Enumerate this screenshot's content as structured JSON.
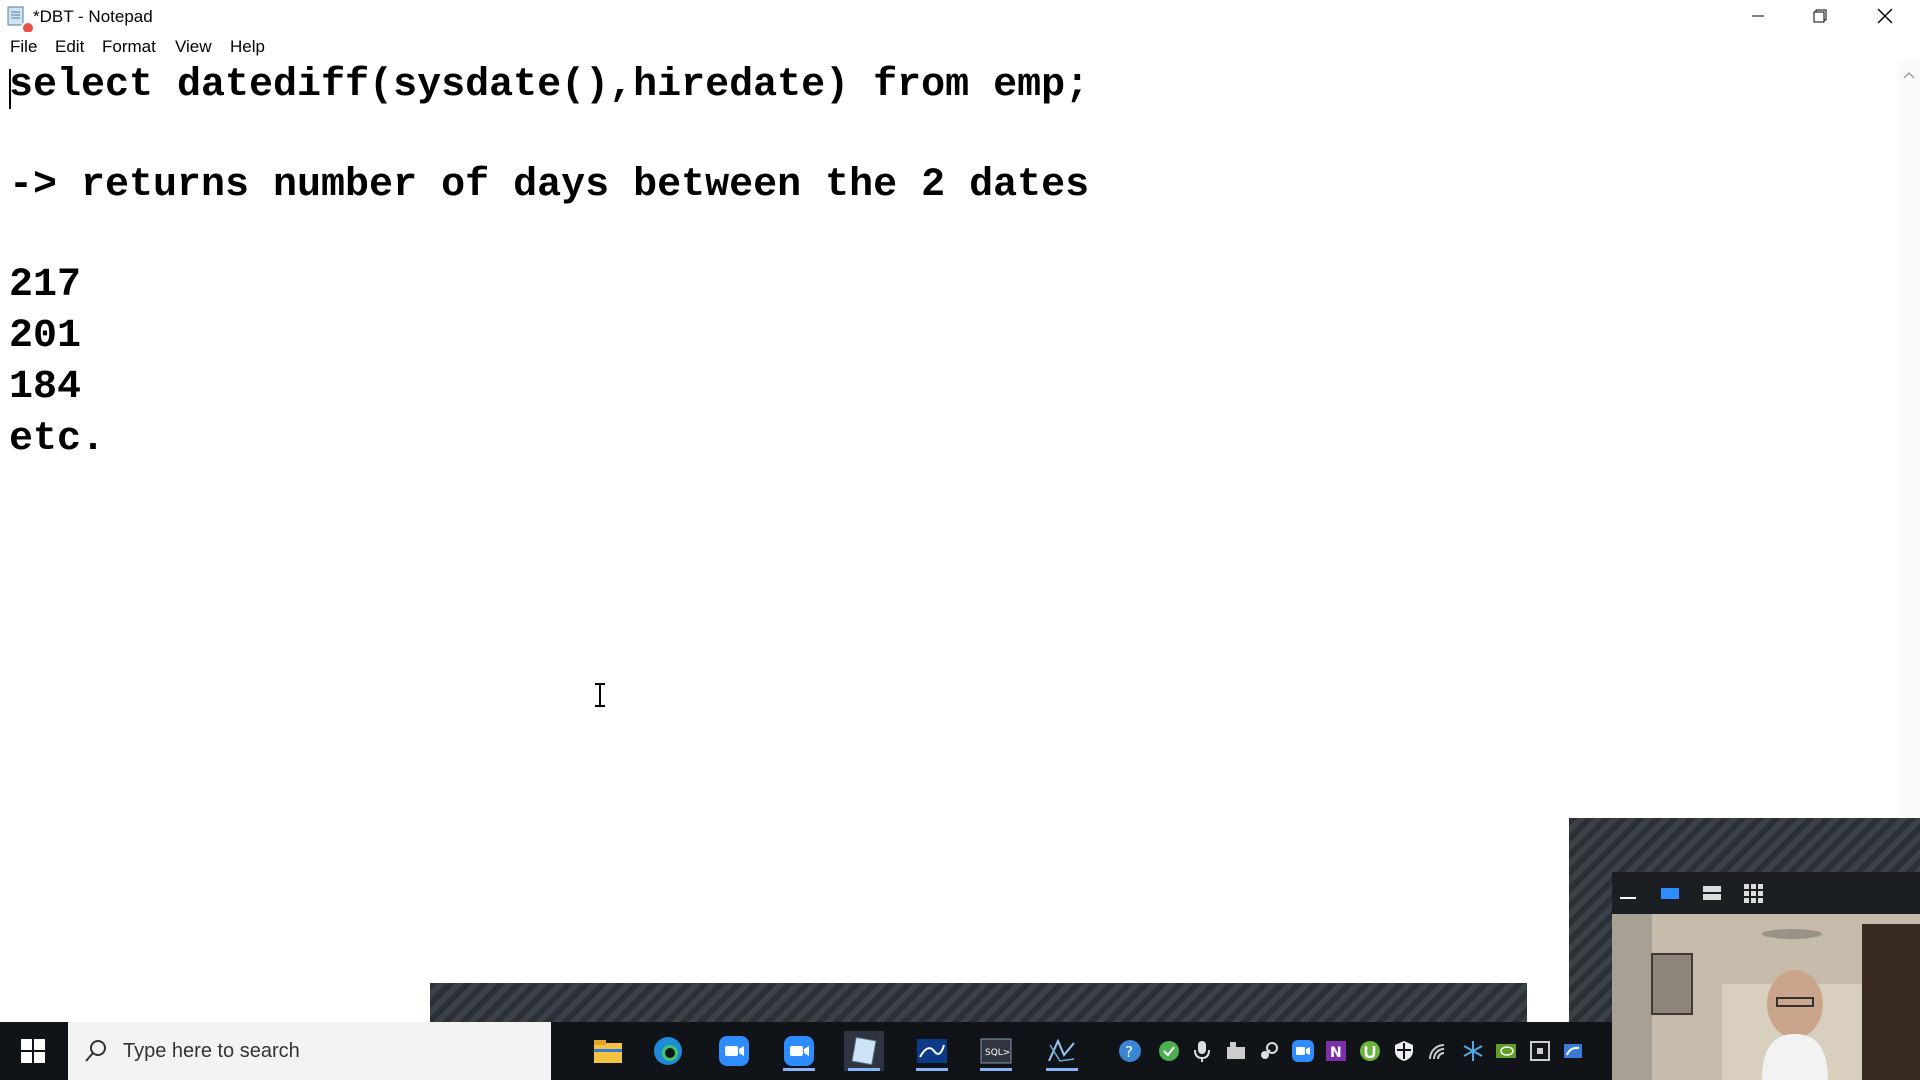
{
  "window": {
    "title": "*DBT - Notepad"
  },
  "menu": {
    "items": [
      "File",
      "Edit",
      "Format",
      "View",
      "Help"
    ]
  },
  "editor": {
    "lines": [
      "select datediff(sysdate(),hiredate) from emp;",
      "-> returns number of days between the 2 dates",
      "217",
      "201",
      "184",
      "etc."
    ]
  },
  "taskbar": {
    "search_placeholder": "Type here to search",
    "apps": [
      "file-explorer-icon",
      "edge-icon",
      "zoom-icon",
      "zoom-meetings-icon",
      "notepad-icon",
      "mysql-workbench-icon",
      "sql-plus-icon",
      "data-modeler-icon"
    ],
    "tray": [
      "help-icon",
      "shield-check-icon",
      "microphone-icon",
      "hardware-icon",
      "steam-icon",
      "zoom-tray-icon",
      "onenote-icon",
      "utorrent-icon",
      "defender-icon",
      "wifi-icon",
      "snowflake-icon",
      "nvidia-icon",
      "tray-misc-icon",
      "tray-cloud-icon"
    ]
  },
  "colors": {
    "taskbar_bg": "#101418",
    "zoom_pattern": "#2b3036",
    "record_dot": "#e8524a"
  }
}
